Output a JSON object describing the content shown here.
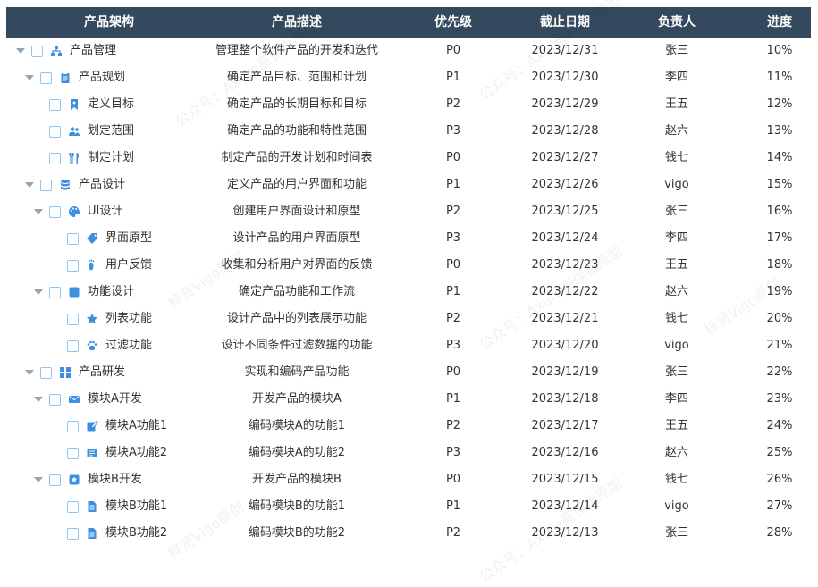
{
  "header": {
    "name": "产品架构",
    "desc": "产品描述",
    "priority": "优先级",
    "deadline": "截止日期",
    "owner": "负责人",
    "progress": "进度"
  },
  "rows": [
    {
      "level": 0,
      "expanded": true,
      "icon": "sitemap-icon",
      "name": "产品管理",
      "desc": "管理整个软件产品的开发和迭代",
      "priority": "P0",
      "deadline": "2023/12/31",
      "owner": "张三",
      "progress": "10%"
    },
    {
      "level": 1,
      "expanded": true,
      "icon": "clipboard-icon",
      "name": "产品规划",
      "desc": "确定产品目标、范围和计划",
      "priority": "P1",
      "deadline": "2023/12/30",
      "owner": "李四",
      "progress": "11%"
    },
    {
      "level": 2,
      "expanded": null,
      "icon": "bookmark-icon",
      "name": "定义目标",
      "desc": "确定产品的长期目标和目标",
      "priority": "P2",
      "deadline": "2023/12/29",
      "owner": "王五",
      "progress": "12%"
    },
    {
      "level": 2,
      "expanded": null,
      "icon": "users-icon",
      "name": "划定范围",
      "desc": "确定产品的功能和特性范围",
      "priority": "P3",
      "deadline": "2023/12/28",
      "owner": "赵六",
      "progress": "13%"
    },
    {
      "level": 2,
      "expanded": null,
      "icon": "utensils-icon",
      "name": "制定计划",
      "desc": "制定产品的开发计划和时间表",
      "priority": "P0",
      "deadline": "2023/12/27",
      "owner": "钱七",
      "progress": "14%"
    },
    {
      "level": 1,
      "expanded": true,
      "icon": "database-icon",
      "name": "产品设计",
      "desc": "定义产品的用户界面和功能",
      "priority": "P1",
      "deadline": "2023/12/26",
      "owner": "vigo",
      "progress": "15%"
    },
    {
      "level": 2,
      "expanded": true,
      "icon": "palette-icon",
      "name": "UI设计",
      "desc": "创建用户界面设计和原型",
      "priority": "P2",
      "deadline": "2023/12/25",
      "owner": "张三",
      "progress": "16%"
    },
    {
      "level": 3,
      "expanded": null,
      "icon": "tag-icon",
      "name": "界面原型",
      "desc": "设计产品的用户界面原型",
      "priority": "P3",
      "deadline": "2023/12/24",
      "owner": "李四",
      "progress": "17%"
    },
    {
      "level": 3,
      "expanded": null,
      "icon": "footprint-icon",
      "name": "用户反馈",
      "desc": "收集和分析用户对界面的反馈",
      "priority": "P0",
      "deadline": "2023/12/23",
      "owner": "王五",
      "progress": "18%"
    },
    {
      "level": 2,
      "expanded": true,
      "icon": "square-icon",
      "name": "功能设计",
      "desc": "确定产品功能和工作流",
      "priority": "P1",
      "deadline": "2023/12/22",
      "owner": "赵六",
      "progress": "19%"
    },
    {
      "level": 3,
      "expanded": null,
      "icon": "star-icon",
      "name": "列表功能",
      "desc": "设计产品中的列表展示功能",
      "priority": "P2",
      "deadline": "2023/12/21",
      "owner": "钱七",
      "progress": "20%"
    },
    {
      "level": 3,
      "expanded": null,
      "icon": "paw-icon",
      "name": "过滤功能",
      "desc": "设计不同条件过滤数据的功能",
      "priority": "P3",
      "deadline": "2023/12/20",
      "owner": "vigo",
      "progress": "21%"
    },
    {
      "level": 1,
      "expanded": true,
      "icon": "grid-icon",
      "name": "产品研发",
      "desc": "实现和编码产品功能",
      "priority": "P0",
      "deadline": "2023/12/19",
      "owner": "张三",
      "progress": "22%"
    },
    {
      "level": 2,
      "expanded": true,
      "icon": "envelope-icon",
      "name": "模块A开发",
      "desc": "开发产品的模块A",
      "priority": "P1",
      "deadline": "2023/12/18",
      "owner": "李四",
      "progress": "23%"
    },
    {
      "level": 3,
      "expanded": null,
      "icon": "edit-icon",
      "name": "模块A功能1",
      "desc": "编码模块A的功能1",
      "priority": "P2",
      "deadline": "2023/12/17",
      "owner": "王五",
      "progress": "24%"
    },
    {
      "level": 3,
      "expanded": null,
      "icon": "form-icon",
      "name": "模块A功能2",
      "desc": "编码模块A的功能2",
      "priority": "P3",
      "deadline": "2023/12/16",
      "owner": "赵六",
      "progress": "25%"
    },
    {
      "level": 2,
      "expanded": true,
      "icon": "star-box-icon",
      "name": "模块B开发",
      "desc": "开发产品的模块B",
      "priority": "P0",
      "deadline": "2023/12/15",
      "owner": "钱七",
      "progress": "26%"
    },
    {
      "level": 3,
      "expanded": null,
      "icon": "doc-icon",
      "name": "模块B功能1",
      "desc": "编码模块B的功能1",
      "priority": "P1",
      "deadline": "2023/12/14",
      "owner": "vigo",
      "progress": "27%"
    },
    {
      "level": 3,
      "expanded": null,
      "icon": "doc-icon",
      "name": "模块B功能2",
      "desc": "编码模块B的功能2",
      "priority": "P2",
      "deadline": "2023/12/13",
      "owner": "张三",
      "progress": "28%"
    }
  ],
  "colors": {
    "header_bg": "#34495e",
    "icon": "#3d8fe0",
    "checkbox_border": "#8ec5f0"
  }
}
